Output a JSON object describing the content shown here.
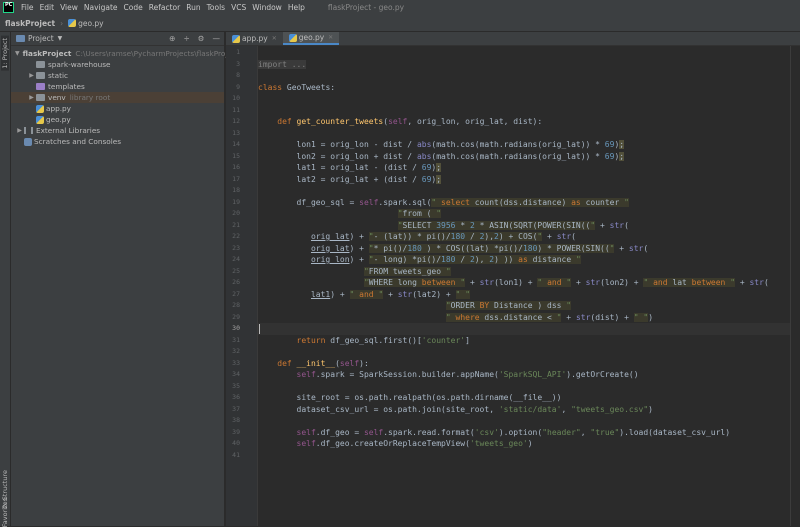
{
  "menubar": {
    "items": [
      "File",
      "Edit",
      "View",
      "Navigate",
      "Code",
      "Refactor",
      "Run",
      "Tools",
      "VCS",
      "Window",
      "Help"
    ],
    "title": "flaskProject - geo.py"
  },
  "navbar": {
    "project": "flaskProject",
    "file": "geo.py"
  },
  "side_tabs": {
    "project": "1: Project",
    "structure": "2: Structure",
    "favorites": "Favorites"
  },
  "project_panel": {
    "title": "Project",
    "tree": [
      {
        "label": "flaskProject",
        "note": "C:\\Users\\ramse\\PycharmProjects\\flaskProject",
        "type": "folder",
        "depth": 0,
        "arrow": "down"
      },
      {
        "label": "spark-warehouse",
        "type": "folder",
        "depth": 1,
        "arrow": ""
      },
      {
        "label": "static",
        "type": "folder",
        "depth": 1,
        "arrow": "right"
      },
      {
        "label": "templates",
        "type": "folder-purple",
        "depth": 1,
        "arrow": ""
      },
      {
        "label": "venv",
        "note": "library root",
        "type": "folder",
        "depth": 1,
        "arrow": "right",
        "selected": true
      },
      {
        "label": "app.py",
        "type": "py",
        "depth": 1,
        "arrow": ""
      },
      {
        "label": "geo.py",
        "type": "py",
        "depth": 1,
        "arrow": ""
      },
      {
        "label": "External Libraries",
        "type": "lib",
        "depth": 0,
        "arrow": "right"
      },
      {
        "label": "Scratches and Consoles",
        "type": "scratch",
        "depth": 0,
        "arrow": ""
      }
    ]
  },
  "tabs": [
    {
      "label": "app.py",
      "active": false
    },
    {
      "label": "geo.py",
      "active": true
    }
  ],
  "editor": {
    "current_line": 30,
    "lines": [
      {
        "n": 1,
        "t": []
      },
      {
        "n": 3,
        "t": [
          [
            "import ...",
            "fold"
          ]
        ]
      },
      {
        "n": 8,
        "t": []
      },
      {
        "n": 9,
        "t": [
          [
            "class ",
            "kw"
          ],
          [
            "GeoTweets:",
            "p"
          ]
        ]
      },
      {
        "n": 10,
        "t": []
      },
      {
        "n": 11,
        "t": []
      },
      {
        "n": 12,
        "t": [
          [
            "    ",
            "p"
          ],
          [
            "def ",
            "kw"
          ],
          [
            "get_counter_tweets",
            "fn"
          ],
          [
            "(",
            "p"
          ],
          [
            "self",
            "sf"
          ],
          [
            ", orig_lon, orig_lat, dist):",
            "p"
          ]
        ]
      },
      {
        "n": 13,
        "t": []
      },
      {
        "n": 14,
        "t": [
          [
            "        lon1 = orig_lon - dist / ",
            "p"
          ],
          [
            "abs",
            "b"
          ],
          [
            "(math.cos(math.radians(orig_lat)) * ",
            "p"
          ],
          [
            "69",
            "n"
          ],
          [
            ")",
            "p"
          ],
          [
            ";",
            "w"
          ]
        ]
      },
      {
        "n": 15,
        "t": [
          [
            "        lon2 = orig_lon + dist / ",
            "p"
          ],
          [
            "abs",
            "b"
          ],
          [
            "(math.cos(math.radians(orig_lat)) * ",
            "p"
          ],
          [
            "69",
            "n"
          ],
          [
            ")",
            "p"
          ],
          [
            ";",
            "w"
          ]
        ]
      },
      {
        "n": 16,
        "t": [
          [
            "        lat1 = orig_lat - (dist / ",
            "p"
          ],
          [
            "69",
            "n"
          ],
          [
            ")",
            "p"
          ],
          [
            ";",
            "w"
          ]
        ]
      },
      {
        "n": 17,
        "t": [
          [
            "        lat2 = orig_lat + (dist / ",
            "p"
          ],
          [
            "69",
            "n"
          ],
          [
            ")",
            "p"
          ],
          [
            ";",
            "w"
          ]
        ]
      },
      {
        "n": 18,
        "t": []
      },
      {
        "n": 19,
        "t": [
          [
            "        df_geo_sql = ",
            "p"
          ],
          [
            "self",
            "sf"
          ],
          [
            ".spark.sql(",
            "p"
          ],
          [
            "\" ",
            "q"
          ],
          [
            "select",
            "k"
          ],
          [
            " count(dss.distance) ",
            "s"
          ],
          [
            "as",
            "k"
          ],
          [
            " counter ",
            "s"
          ],
          [
            "\"",
            "q"
          ]
        ]
      },
      {
        "n": 20,
        "t": [
          [
            "                             ",
            "p"
          ],
          [
            "\"",
            "q"
          ],
          [
            "from ( ",
            "s"
          ],
          [
            "\"",
            "q"
          ]
        ]
      },
      {
        "n": 21,
        "t": [
          [
            "                             ",
            "p"
          ],
          [
            "\"",
            "q"
          ],
          [
            "SELECT ",
            "s"
          ],
          [
            "3956",
            "sn"
          ],
          [
            " * ",
            "s"
          ],
          [
            "2",
            "sn"
          ],
          [
            " * ASIN(SQRT(POWER(SIN((",
            "s"
          ],
          [
            "\"",
            "q"
          ],
          [
            " + ",
            "p"
          ],
          [
            "str",
            "b"
          ],
          [
            "(",
            "p"
          ]
        ]
      },
      {
        "n": 22,
        "t": [
          [
            "           ",
            "p"
          ],
          [
            "orig_lat",
            "u"
          ],
          [
            ") + ",
            "p"
          ],
          [
            "\"",
            "q"
          ],
          [
            "- (lat)) * pi()/",
            "s"
          ],
          [
            "180",
            "sn"
          ],
          [
            " / ",
            "s"
          ],
          [
            "2",
            "sn"
          ],
          [
            "),",
            "s"
          ],
          [
            "2",
            "sn"
          ],
          [
            ") + COS(",
            "s"
          ],
          [
            "\"",
            "q"
          ],
          [
            " + ",
            "p"
          ],
          [
            "str",
            "b"
          ],
          [
            "(",
            "p"
          ]
        ]
      },
      {
        "n": 23,
        "t": [
          [
            "           ",
            "p"
          ],
          [
            "orig_lat",
            "u"
          ],
          [
            ") + ",
            "p"
          ],
          [
            "\"",
            "q"
          ],
          [
            "* pi()/",
            "s"
          ],
          [
            "180",
            "sn"
          ],
          [
            " ) * COS((lat) *pi()/",
            "s"
          ],
          [
            "180",
            "sn"
          ],
          [
            ") * POWER(SIN((",
            "s"
          ],
          [
            "\"",
            "q"
          ],
          [
            " + ",
            "p"
          ],
          [
            "str",
            "b"
          ],
          [
            "(",
            "p"
          ]
        ]
      },
      {
        "n": 24,
        "t": [
          [
            "           ",
            "p"
          ],
          [
            "orig_lon",
            "u"
          ],
          [
            ") + ",
            "p"
          ],
          [
            "\"",
            "q"
          ],
          [
            "- long) *pi()/",
            "s"
          ],
          [
            "180",
            "sn"
          ],
          [
            " / ",
            "s"
          ],
          [
            "2",
            "sn"
          ],
          [
            "), ",
            "s"
          ],
          [
            "2",
            "sn"
          ],
          [
            ") )) ",
            "s"
          ],
          [
            "as",
            "k"
          ],
          [
            " distance ",
            "s"
          ],
          [
            "\"",
            "q"
          ]
        ]
      },
      {
        "n": 25,
        "t": [
          [
            "                      ",
            "p"
          ],
          [
            "\"",
            "q"
          ],
          [
            "FROM tweets_geo ",
            "s"
          ],
          [
            "\"",
            "q"
          ]
        ]
      },
      {
        "n": 26,
        "t": [
          [
            "                      ",
            "p"
          ],
          [
            "\"",
            "q"
          ],
          [
            "WHERE long ",
            "s"
          ],
          [
            "between",
            "k"
          ],
          [
            " ",
            "s"
          ],
          [
            "\"",
            "q"
          ],
          [
            " + ",
            "p"
          ],
          [
            "str",
            "b"
          ],
          [
            "(lon1) + ",
            "p"
          ],
          [
            "\"",
            "q"
          ],
          [
            " ",
            "s"
          ],
          [
            "and",
            "k"
          ],
          [
            " ",
            "s"
          ],
          [
            "\"",
            "q"
          ],
          [
            " + ",
            "p"
          ],
          [
            "str",
            "b"
          ],
          [
            "(lon2) + ",
            "p"
          ],
          [
            "\"",
            "q"
          ],
          [
            " ",
            "s"
          ],
          [
            "and",
            "k"
          ],
          [
            " lat ",
            "s"
          ],
          [
            "between",
            "k"
          ],
          [
            " ",
            "s"
          ],
          [
            "\"",
            "q"
          ],
          [
            " + ",
            "p"
          ],
          [
            "str",
            "b"
          ],
          [
            "(",
            "p"
          ]
        ]
      },
      {
        "n": 27,
        "t": [
          [
            "           ",
            "p"
          ],
          [
            "lat1",
            "u"
          ],
          [
            ") + ",
            "p"
          ],
          [
            "\"",
            "q"
          ],
          [
            " ",
            "s"
          ],
          [
            "and",
            "k"
          ],
          [
            " ",
            "s"
          ],
          [
            "\"",
            "q"
          ],
          [
            " + ",
            "p"
          ],
          [
            "str",
            "b"
          ],
          [
            "(lat2) + ",
            "p"
          ],
          [
            "\"",
            "q"
          ],
          [
            " ",
            "s"
          ],
          [
            "\"",
            "q"
          ]
        ]
      },
      {
        "n": 28,
        "t": [
          [
            "                                       ",
            "p"
          ],
          [
            "\"",
            "q"
          ],
          [
            "ORDER ",
            "s"
          ],
          [
            "BY",
            "k"
          ],
          [
            " Distance ) dss ",
            "s"
          ],
          [
            "\"",
            "q"
          ]
        ]
      },
      {
        "n": 29,
        "t": [
          [
            "                                       ",
            "p"
          ],
          [
            "\"",
            "q"
          ],
          [
            " ",
            "s"
          ],
          [
            "where",
            "k"
          ],
          [
            " dss.distance < ",
            "s"
          ],
          [
            "\"",
            "q"
          ],
          [
            " + ",
            "p"
          ],
          [
            "str",
            "b"
          ],
          [
            "(dist) + ",
            "p"
          ],
          [
            "\"",
            "q"
          ],
          [
            " ",
            "s"
          ],
          [
            "\"",
            "q"
          ],
          [
            ")",
            "p"
          ]
        ]
      },
      {
        "n": 30,
        "t": []
      },
      {
        "n": 31,
        "t": [
          [
            "        ",
            "p"
          ],
          [
            "return ",
            "kw"
          ],
          [
            "df_geo_sql.first()[",
            "p"
          ],
          [
            "'counter'",
            "st"
          ],
          [
            "]",
            "p"
          ]
        ]
      },
      {
        "n": 32,
        "t": []
      },
      {
        "n": 33,
        "t": [
          [
            "    ",
            "p"
          ],
          [
            "def ",
            "kw"
          ],
          [
            "__init__",
            "fn"
          ],
          [
            "(",
            "p"
          ],
          [
            "self",
            "sf"
          ],
          [
            "):",
            "p"
          ]
        ]
      },
      {
        "n": 34,
        "t": [
          [
            "        ",
            "p"
          ],
          [
            "self",
            "sf"
          ],
          [
            ".spark = SparkSession.builder.appName(",
            "p"
          ],
          [
            "'SparkSQL_API'",
            "st"
          ],
          [
            ").getOrCreate()",
            "p"
          ]
        ]
      },
      {
        "n": 35,
        "t": []
      },
      {
        "n": 36,
        "t": [
          [
            "        site_root = os.path.realpath(os.path.dirname(__file__))",
            "p"
          ]
        ]
      },
      {
        "n": 37,
        "t": [
          [
            "        dataset_csv_url = os.path.join(site_root, ",
            "p"
          ],
          [
            "'static/data'",
            "st"
          ],
          [
            ", ",
            "p"
          ],
          [
            "\"tweets_geo.csv\"",
            "st"
          ],
          [
            ")",
            "p"
          ]
        ]
      },
      {
        "n": 38,
        "t": []
      },
      {
        "n": 39,
        "t": [
          [
            "        ",
            "p"
          ],
          [
            "self",
            "sf"
          ],
          [
            ".df_geo = ",
            "p"
          ],
          [
            "self",
            "sf"
          ],
          [
            ".spark.read.format(",
            "p"
          ],
          [
            "'csv'",
            "st"
          ],
          [
            ").option(",
            "p"
          ],
          [
            "\"header\"",
            "st"
          ],
          [
            ", ",
            "p"
          ],
          [
            "\"true\"",
            "st"
          ],
          [
            ").load(dataset_csv_url)",
            "p"
          ]
        ]
      },
      {
        "n": 40,
        "t": [
          [
            "        ",
            "p"
          ],
          [
            "self",
            "sf"
          ],
          [
            ".df_geo.createOrReplaceTempView(",
            "p"
          ],
          [
            "'tweets_geo'",
            "st"
          ],
          [
            ")",
            "p"
          ]
        ]
      },
      {
        "n": 41,
        "t": []
      }
    ]
  }
}
